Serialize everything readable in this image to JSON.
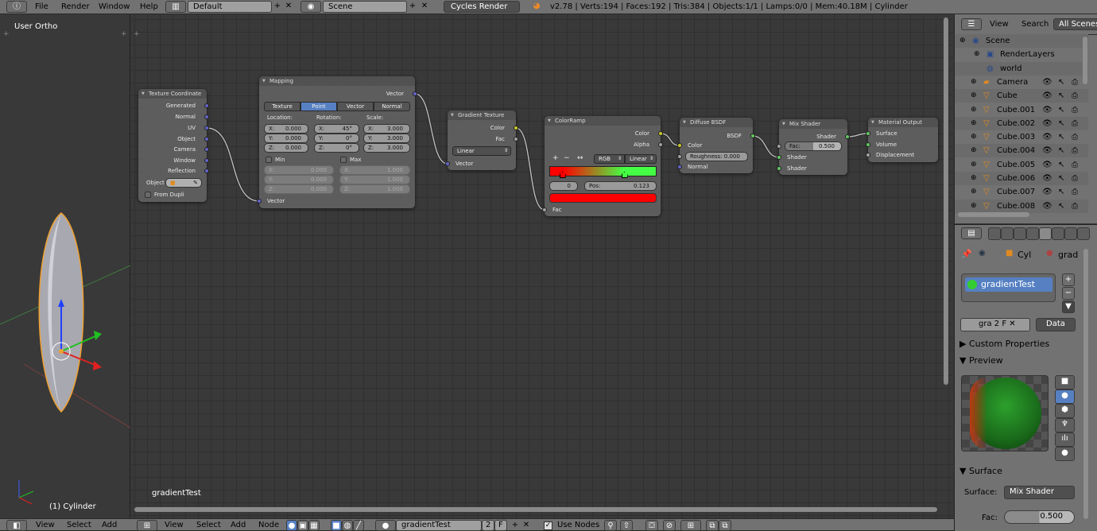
{
  "top_bar": {
    "menus": [
      "File",
      "Render",
      "Window",
      "Help"
    ],
    "layout": "Default",
    "scene": "Scene",
    "engine": "Cycles Render",
    "info": "v2.78 | Verts:194 | Faces:192 | Tris:384 | Objects:1/1 | Lamps:0/0 | Mem:40.18M | Cylinder",
    "icons": [
      "info-icon",
      "screen-layout-icon",
      "scene-icon",
      "blender-logo-icon"
    ]
  },
  "viewport": {
    "view_label": "User Ortho",
    "object_label": "(1) Cylinder",
    "menus": [
      "View",
      "Select",
      "Add"
    ]
  },
  "node_editor": {
    "material_label": "gradientTest",
    "menus": [
      "View",
      "Select",
      "Add",
      "Node"
    ],
    "material_name": "gradientTest",
    "users": "2",
    "fake_user": "F",
    "use_nodes_label": "Use Nodes",
    "use_nodes": true
  },
  "nodes": {
    "texcoord": {
      "title": "Texture Coordinate",
      "outputs": [
        "Generated",
        "Normal",
        "UV",
        "Object",
        "Camera",
        "Window",
        "Reflection"
      ],
      "object_label": "Object",
      "from_dupli": "From Dupli"
    },
    "mapping": {
      "title": "Mapping",
      "output": "Vector",
      "tabs": [
        "Texture",
        "Point",
        "Vector",
        "Normal"
      ],
      "active_tab": "Point",
      "location_label": "Location:",
      "rotation_label": "Rotation:",
      "scale_label": "Scale:",
      "location": {
        "x": "0.000",
        "y": "0.000",
        "z": "0.000"
      },
      "rotation": {
        "x": "45°",
        "y": "0°",
        "z": "0°"
      },
      "scale": {
        "x": "3.000",
        "y": "3.000",
        "z": "3.000"
      },
      "min_label": "Min",
      "max_label": "Max",
      "min": {
        "x": "0.000",
        "y": "0.000",
        "z": "0.000"
      },
      "max": {
        "x": "1.000",
        "y": "1.000",
        "z": "1.000"
      },
      "input": "Vector",
      "axis": [
        "X:",
        "Y:",
        "Z:"
      ]
    },
    "gradient": {
      "title": "Gradient Texture",
      "outputs": [
        "Color",
        "Fac"
      ],
      "type": "Linear",
      "input": "Vector"
    },
    "colorramp": {
      "title": "ColorRamp",
      "outputs": [
        "Color",
        "Alpha"
      ],
      "mode": "RGB",
      "interpolation": "Linear",
      "stop_index": "0",
      "pos_label": "Pos:",
      "pos": "0.123",
      "input": "Fac",
      "stops": [
        {
          "pos": 0.123,
          "color": "#ff0000"
        },
        {
          "pos": 0.7,
          "color": "#44ff44"
        }
      ],
      "active_color": "#ff0000"
    },
    "diffuse": {
      "title": "Diffuse BSDF",
      "output": "BSDF",
      "inputs": [
        "Color",
        "Normal"
      ],
      "roughness_label": "Roughness:",
      "roughness": "0.000"
    },
    "mix": {
      "title": "Mix Shader",
      "output": "Shader",
      "fac_label": "Fac:",
      "fac": "0.500",
      "inputs": [
        "Shader",
        "Shader"
      ]
    },
    "output": {
      "title": "Material Output",
      "inputs": [
        "Surface",
        "Volume",
        "Displacement"
      ]
    }
  },
  "outliner": {
    "menus": [
      "View",
      "Search"
    ],
    "filter": "All Scenes",
    "items": [
      "Scene",
      "RenderLayers",
      "world",
      "Camera",
      "Cube",
      "Cube.001",
      "Cube.002",
      "Cube.003",
      "Cube.004",
      "Cube.005",
      "Cube.006",
      "Cube.007",
      "Cube.008"
    ]
  },
  "properties": {
    "breadcrumb": [
      "Cyl",
      "grad"
    ],
    "material_slot": "gradientTest",
    "material_short": "gra",
    "users": "2",
    "fake": "F",
    "link": "Data",
    "panels": {
      "custom": "Custom Properties",
      "preview": "Preview",
      "surface": "Surface"
    },
    "surface_label": "Surface:",
    "surface_value": "Mix Shader",
    "fac_label": "Fac:",
    "fac_value": "0.500"
  },
  "colors": {
    "vector_socket": "#6363c7",
    "color_socket": "#c7c729",
    "shader_socket": "#63c763",
    "selection": "#5680c2",
    "object_outline": "#f0a030"
  }
}
